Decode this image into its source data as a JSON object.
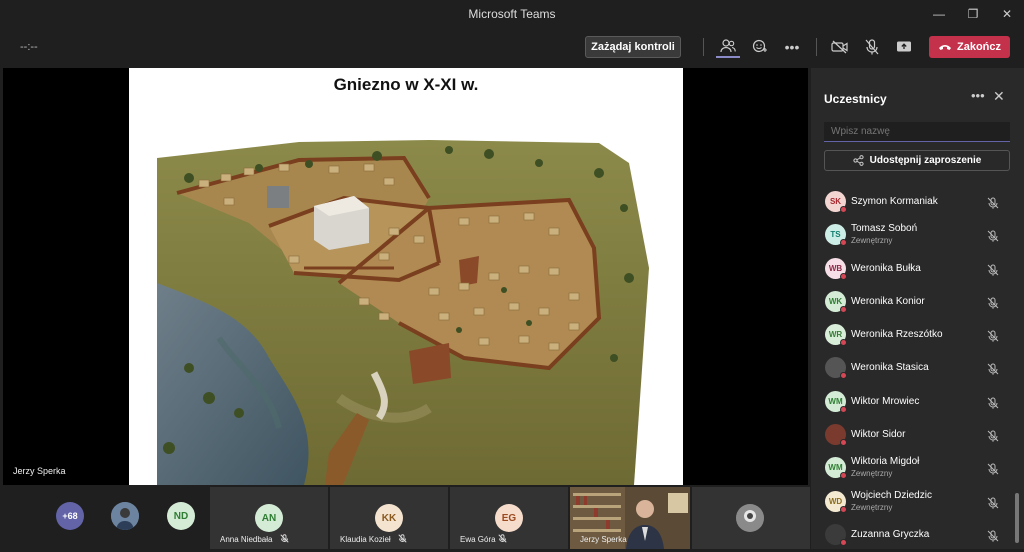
{
  "window": {
    "title": "Microsoft Teams"
  },
  "toolbar": {
    "timer": "--:--",
    "request_control": "Zażądaj kontroli",
    "end_call": "Zakończ"
  },
  "stage": {
    "slide_title": "Gniezno w X-XI w.",
    "presenter": "Jerzy Sperka"
  },
  "panel": {
    "title": "Uczestnicy",
    "search_placeholder": "Wpisz nazwę",
    "share_label": "Udostępnij zaproszenie",
    "participants": [
      {
        "initials": "SK",
        "name": "Szymon Kormaniak",
        "sub": "",
        "bg": "#f3d5d2",
        "fg": "#a4262c"
      },
      {
        "initials": "TS",
        "name": "Tomasz Soboń",
        "sub": "Zewnętrzny",
        "bg": "#cdeee6",
        "fg": "#107c6d"
      },
      {
        "initials": "WB",
        "name": "Weronika Bułka",
        "sub": "",
        "bg": "#f6dfe6",
        "fg": "#8a2a47"
      },
      {
        "initials": "WK",
        "name": "Weronika Konior",
        "sub": "",
        "bg": "#d4ecd6",
        "fg": "#2e7d32"
      },
      {
        "initials": "WR",
        "name": "Weronika Rzeszótko",
        "sub": "",
        "bg": "#d9eed9",
        "fg": "#3a7a3a"
      },
      {
        "initials": "",
        "name": "Weronika Stasica",
        "sub": "",
        "bg": "#555555",
        "fg": "#ffffff"
      },
      {
        "initials": "WM",
        "name": "Wiktor Mrowiec",
        "sub": "",
        "bg": "#d4ecd6",
        "fg": "#2e7d32"
      },
      {
        "initials": "",
        "name": "Wiktor Sidor",
        "sub": "",
        "bg": "#7a3b2e",
        "fg": "#ffffff"
      },
      {
        "initials": "WM",
        "name": "Wiktoria Migdoł",
        "sub": "Zewnętrzny",
        "bg": "#d4ecd6",
        "fg": "#2e7d32"
      },
      {
        "initials": "WD",
        "name": "Wojciech Dziedzic",
        "sub": "Zewnętrzny",
        "bg": "#f4ead2",
        "fg": "#8a6d1f"
      },
      {
        "initials": "",
        "name": "Zuzanna Gryczka",
        "sub": "",
        "bg": "#3b3b3b",
        "fg": "#ffffff"
      }
    ]
  },
  "bottom": {
    "more_count": "+68",
    "nd": "ND",
    "tiles": [
      {
        "initials": "AN",
        "name": "Anna Niedbała"
      },
      {
        "initials": "KK",
        "name": "Klaudia Kozieł"
      },
      {
        "initials": "EG",
        "name": "Ewa Góra"
      },
      {
        "initials": "",
        "name": "Jerzy Sperka"
      }
    ]
  }
}
